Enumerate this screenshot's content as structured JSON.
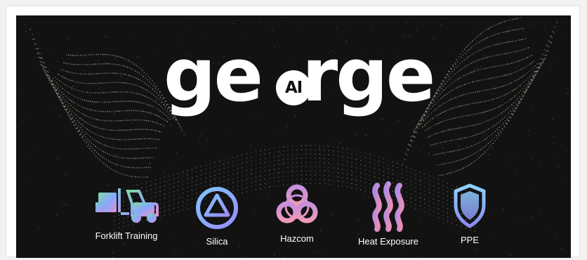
{
  "logo": {
    "text_before": "ge",
    "badge": "AI",
    "text_after": "rge"
  },
  "topics": [
    {
      "label": "Forklift Training",
      "icon": "forklift-icon"
    },
    {
      "label": "Silica",
      "icon": "triangle-in-circle-icon"
    },
    {
      "label": "Hazcom",
      "icon": "biohazard-icon"
    },
    {
      "label": "Heat Exposure",
      "icon": "heat-waves-icon"
    },
    {
      "label": "PPE",
      "icon": "shield-icon"
    }
  ],
  "colors": {
    "background": "#121212",
    "text": "#ffffff",
    "gradient_start": "#7fd9a6",
    "gradient_mid": "#8aa6ff",
    "gradient_end": "#e58fc8"
  }
}
